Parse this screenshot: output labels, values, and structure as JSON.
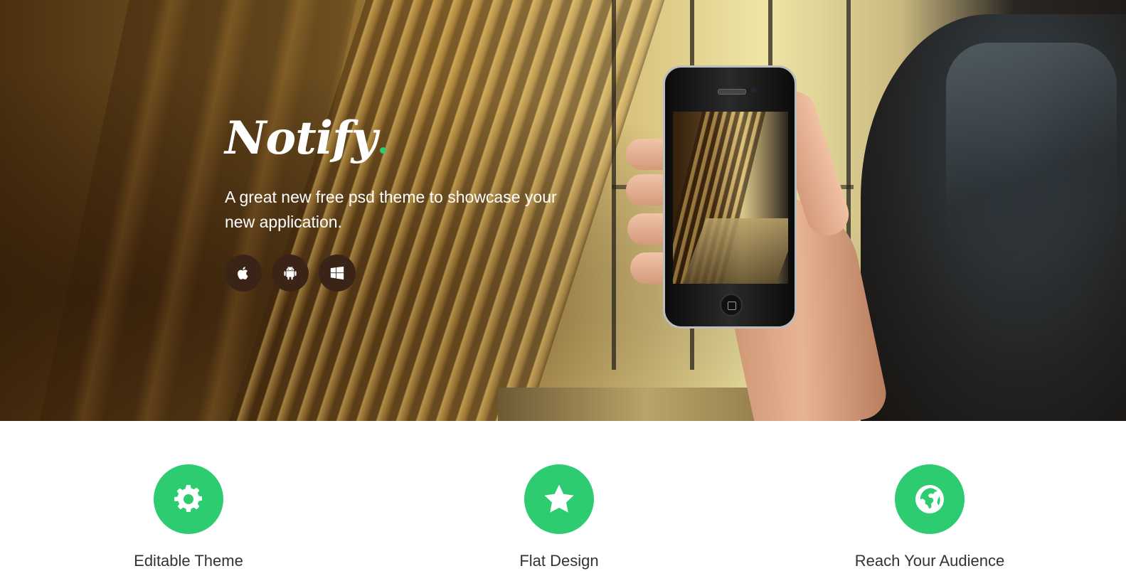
{
  "hero": {
    "brand": "Notify",
    "tagline": "A great new free psd theme to showcase your new application.",
    "platforms": [
      {
        "name": "apple-icon"
      },
      {
        "name": "android-icon"
      },
      {
        "name": "windows-icon"
      }
    ]
  },
  "features": [
    {
      "icon": "gear-icon",
      "title": "Editable Theme"
    },
    {
      "icon": "star-icon",
      "title": "Flat Design"
    },
    {
      "icon": "globe-icon",
      "title": "Reach Your Audience"
    }
  ],
  "colors": {
    "accent": "#2ecc71",
    "platform_button": "#3a2418",
    "text_dark": "#333333"
  }
}
